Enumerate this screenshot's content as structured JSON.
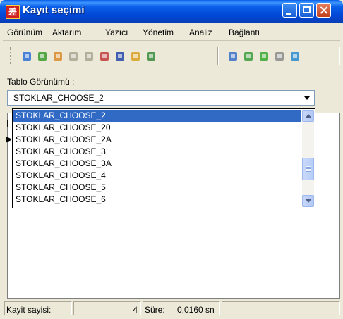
{
  "window": {
    "title": "Kayıt seçimi",
    "app_icon_glyph": "差"
  },
  "menu": [
    "Görünüm",
    "Aktarım",
    "Yazıcı",
    "Yönetim",
    "Analiz",
    "Bağlantı"
  ],
  "toolbar": {
    "icons": [
      {
        "name": "refresh-icon",
        "color": "#2c6fd6"
      },
      {
        "name": "add-record-icon",
        "color": "#3a9a2e"
      },
      {
        "name": "grid-icon",
        "color": "#d98a2c"
      },
      {
        "name": "tree-icon",
        "color": "#a8a48f"
      },
      {
        "name": "filter-icon",
        "color": "#a8a48f"
      },
      {
        "name": "table-edit-icon",
        "color": "#c03a3a"
      },
      {
        "name": "save-icon",
        "color": "#2345a8"
      },
      {
        "name": "recycle-icon",
        "color": "#d8a020"
      },
      {
        "name": "network-icon",
        "color": "#3a8a3a"
      },
      {
        "name": "document-icon",
        "color": "#3a6fc8"
      },
      {
        "name": "globe-refresh-icon",
        "color": "#3a9a3a"
      },
      {
        "name": "arrow-right-icon",
        "color": "#36a82e"
      },
      {
        "name": "find-icon",
        "color": "#8a8a8a"
      },
      {
        "name": "preview-icon",
        "color": "#2a8ad0"
      }
    ]
  },
  "view_selector": {
    "label": "Tablo Görünümü :",
    "selected": "STOKLAR_CHOOSE_2",
    "options": [
      "STOKLAR_CHOOSE_2",
      "STOKLAR_CHOOSE_20",
      "STOKLAR_CHOOSE_2A",
      "STOKLAR_CHOOSE_3",
      "STOKLAR_CHOOSE_3A",
      "STOKLAR_CHOOSE_4",
      "STOKLAR_CHOOSE_5",
      "STOKLAR_CHOOSE_6"
    ]
  },
  "status": {
    "record_count_label": "Kayit sayisi:",
    "record_count": "4",
    "duration_label": "Süre:",
    "duration": "0,0160 sn"
  },
  "colors": {
    "title_bar": "#0a5fe8",
    "selection": "#316ac5",
    "window_bg": "#ece9d8"
  }
}
